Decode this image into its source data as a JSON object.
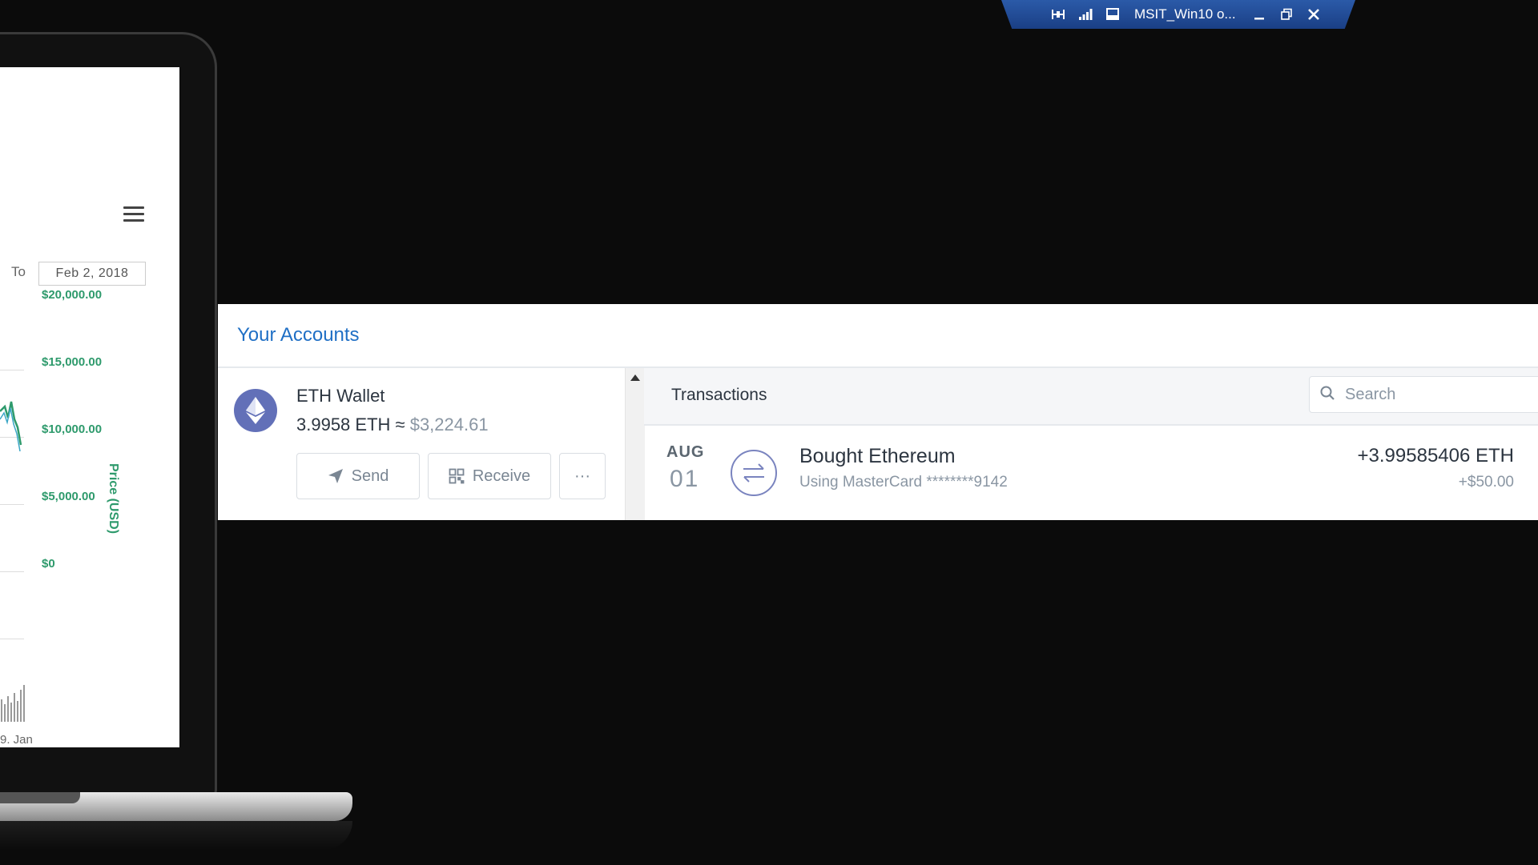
{
  "remote_bar": {
    "title": "MSIT_Win10 o...",
    "icons": [
      "pin-icon",
      "signal-icon",
      "monitor-icon",
      "minimize-icon",
      "restore-icon",
      "close-icon"
    ]
  },
  "laptop": {
    "to_label": "To",
    "date_value": "Feb 2, 2018",
    "y_ticks": [
      "$20,000.00",
      "$15,000.00",
      "$10,000.00",
      "$5,000.00",
      "$0"
    ],
    "y_axis_title": "Price (USD)",
    "x_tick": "9. Jan",
    "series_color": "#2e9a6c"
  },
  "accounts": {
    "title": "Your Accounts",
    "wallet": {
      "icon": "ethereum-icon",
      "name": "ETH Wallet",
      "balance": "3.9958 ETH ≈",
      "fiat": " $3,224.61",
      "send_label": "Send",
      "receive_label": "Receive",
      "more_label": "···"
    },
    "transactions": {
      "title": "Transactions",
      "search_placeholder": "Search",
      "rows": [
        {
          "month": "AUG",
          "day": "01",
          "title": "Bought Ethereum",
          "subtitle": "Using MasterCard ********9142",
          "amount": "+3.99585406 ETH",
          "amount_usd": "+$50.00"
        }
      ]
    }
  },
  "colors": {
    "accent": "#1f6fc5",
    "eth_purple": "#6270b8",
    "chart_green": "#2e9a6c",
    "rdp_blue": "#1a3f85"
  }
}
